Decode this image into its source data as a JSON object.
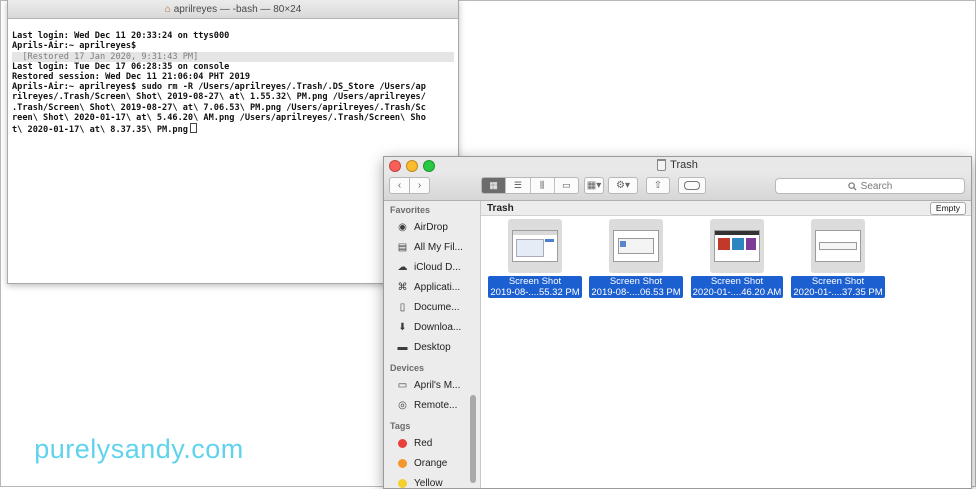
{
  "terminal": {
    "title": "aprilreyes — -bash — 80×24",
    "lines": [
      "Last login: Wed Dec 11 20:33:24 on ttys000",
      "Aprils-Air:~ aprilreyes$",
      "  [Restored 17 Jan 2020, 9:31:43 PM]",
      "Last login: Tue Dec 17 06:28:35 on console",
      "Restored session: Wed Dec 11 21:06:04 PHT 2019",
      "Aprils-Air:~ aprilreyes$ sudo rm -R /Users/aprilreyes/.Trash/.DS_Store /Users/ap",
      "rilreyes/.Trash/Screen\\ Shot\\ 2019-08-27\\ at\\ 1.55.32\\ PM.png /Users/aprilreyes/",
      ".Trash/Screen\\ Shot\\ 2019-08-27\\ at\\ 7.06.53\\ PM.png /Users/aprilreyes/.Trash/Sc",
      "reen\\ Shot\\ 2020-01-17\\ at\\ 5.46.20\\ AM.png /Users/aprilreyes/.Trash/Screen\\ Sho",
      "t\\ 2020-01-17\\ at\\ 8.37.35\\ PM.png"
    ]
  },
  "finder": {
    "title": "Trash",
    "search_placeholder": "Search",
    "path_title": "Trash",
    "empty_label": "Empty",
    "sidebar": {
      "favorites_header": "Favorites",
      "favorites": [
        {
          "label": "AirDrop",
          "icon": "airdrop-icon"
        },
        {
          "label": "All My Fil...",
          "icon": "all-my-files-icon"
        },
        {
          "label": "iCloud D...",
          "icon": "icloud-icon"
        },
        {
          "label": "Applicati...",
          "icon": "applications-icon"
        },
        {
          "label": "Docume...",
          "icon": "documents-icon"
        },
        {
          "label": "Downloa...",
          "icon": "downloads-icon"
        },
        {
          "label": "Desktop",
          "icon": "desktop-icon"
        }
      ],
      "devices_header": "Devices",
      "devices": [
        {
          "label": "April's M...",
          "icon": "laptop-icon"
        },
        {
          "label": "Remote...",
          "icon": "disc-icon"
        }
      ],
      "tags_header": "Tags",
      "tags": [
        {
          "label": "Red",
          "color": "#e8403a"
        },
        {
          "label": "Orange",
          "color": "#f5962a"
        },
        {
          "label": "Yellow",
          "color": "#f3d02c"
        }
      ]
    },
    "files": [
      {
        "line1": "Screen Shot",
        "line2": "2019-08-....55.32 PM"
      },
      {
        "line1": "Screen Shot",
        "line2": "2019-08-....06.53 PM"
      },
      {
        "line1": "Screen Shot",
        "line2": "2020-01-....46.20 AM"
      },
      {
        "line1": "Screen Shot",
        "line2": "2020-01-....37.35 PM"
      }
    ]
  },
  "watermark": "purelysandy.com",
  "colors": {
    "selection_blue": "#1c5fd0",
    "watermark_cyan": "#5fd3ec"
  }
}
